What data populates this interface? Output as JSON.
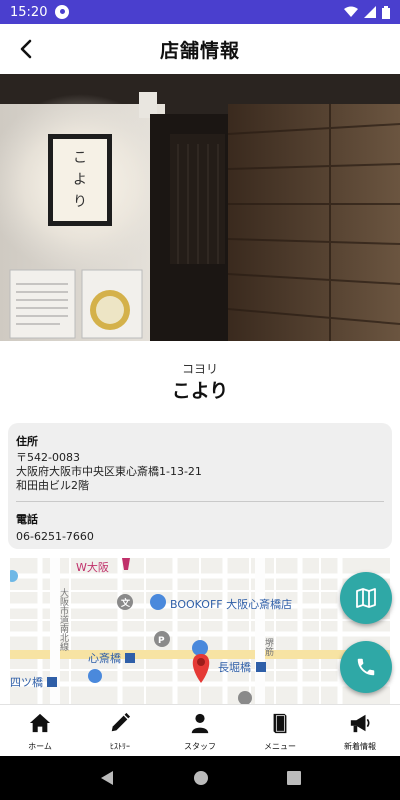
{
  "status_bar": {
    "time": "15:20"
  },
  "header": {
    "title": "店舗情報"
  },
  "store": {
    "kana": "コヨリ",
    "name": "こより",
    "sign_text": "こより"
  },
  "info": {
    "address_label": "住所",
    "postal_code": "〒542-0083",
    "address_line1": "大阪府大阪市中央区東心斎橋1-13-21",
    "address_line2": "和田由ビル2階",
    "phone_label": "電話",
    "phone": "06-6251-7660"
  },
  "map": {
    "labels": {
      "w_osaka": "W大阪",
      "bookoff": "BOOKOFF 大阪心斎橋店",
      "shinsaibashi": "心斎橋",
      "nagahoribashi": "長堀橋",
      "yotsubashi": "四ツ橋",
      "street_left": "大阪市道南北線",
      "street_right": "堺筋"
    }
  },
  "bottom_nav": [
    {
      "label": "ホーム",
      "icon": "home-icon"
    },
    {
      "label": "ﾋｽﾄﾘｰ",
      "icon": "pencil-icon"
    },
    {
      "label": "スタッフ",
      "icon": "person-icon"
    },
    {
      "label": "メニュー",
      "icon": "book-icon"
    },
    {
      "label": "新着情報",
      "icon": "megaphone-icon"
    }
  ],
  "colors": {
    "status_bar": "#4a3fce",
    "fab": "#2fa8a6",
    "card_bg": "#efefef"
  }
}
